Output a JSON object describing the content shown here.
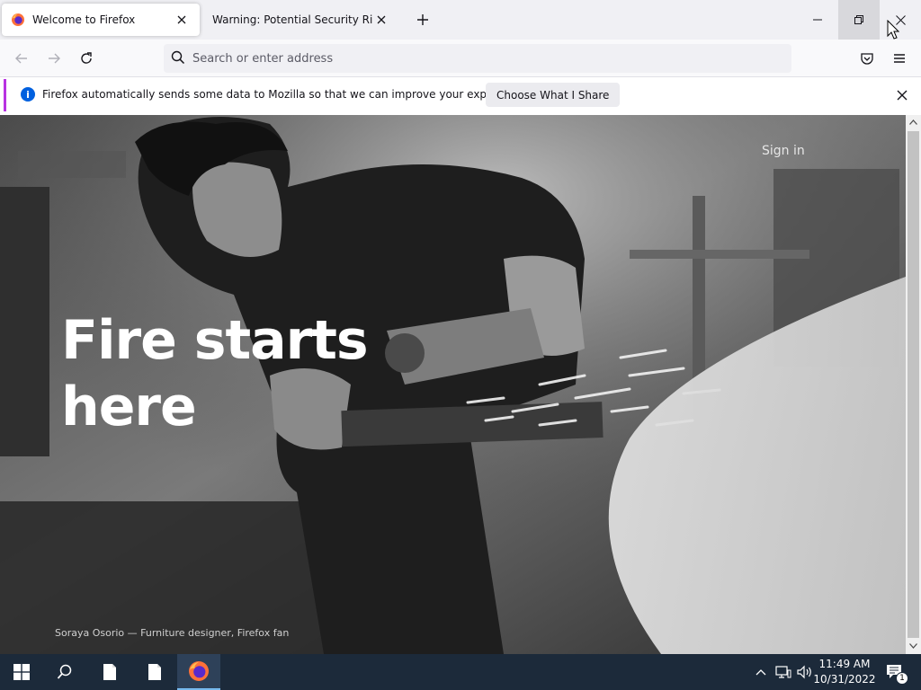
{
  "tabs": [
    {
      "title": "Welcome to Firefox",
      "active": true
    },
    {
      "title": "Warning: Potential Security Risk Ahead",
      "active": false
    }
  ],
  "toolbar": {
    "address_placeholder": "Search or enter address"
  },
  "notification": {
    "text": "Firefox automatically sends some data to Mozilla so that we can improve your experience.",
    "button_label": "Choose What I Share"
  },
  "page": {
    "sign_in": "Sign in",
    "headline_line1": "Fire starts",
    "headline_line2": "here",
    "caption": "Soraya Osorio — Furniture designer, Firefox fan"
  },
  "taskbar": {
    "time": "11:49 AM",
    "date": "10/31/2022",
    "notification_count": "1"
  },
  "colors": {
    "notification_accent": "#b833e1",
    "info_blue": "#0060df",
    "taskbar": "#1c2a3a"
  }
}
